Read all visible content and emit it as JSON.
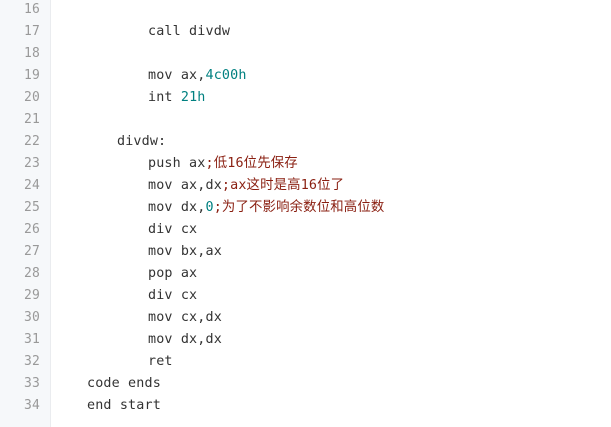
{
  "code_view": {
    "lines": [
      {
        "number": "16",
        "indent": 0,
        "segments": []
      },
      {
        "number": "17",
        "indent": 3,
        "segments": [
          {
            "text": "call divdw",
            "kind": "plain"
          }
        ]
      },
      {
        "number": "18",
        "indent": 0,
        "segments": []
      },
      {
        "number": "19",
        "indent": 3,
        "segments": [
          {
            "text": "mov ax,",
            "kind": "plain"
          },
          {
            "text": "4c00h",
            "kind": "num"
          }
        ]
      },
      {
        "number": "20",
        "indent": 3,
        "segments": [
          {
            "text": "int ",
            "kind": "plain"
          },
          {
            "text": "21h",
            "kind": "num"
          }
        ]
      },
      {
        "number": "21",
        "indent": 0,
        "segments": []
      },
      {
        "number": "22",
        "indent": 2,
        "segments": [
          {
            "text": "divdw:",
            "kind": "plain"
          }
        ]
      },
      {
        "number": "23",
        "indent": 3,
        "segments": [
          {
            "text": "push ax",
            "kind": "plain"
          },
          {
            "text": ";低16位先保存",
            "kind": "cmt"
          }
        ]
      },
      {
        "number": "24",
        "indent": 3,
        "segments": [
          {
            "text": "mov ax,dx",
            "kind": "plain"
          },
          {
            "text": ";ax这时是高16位了",
            "kind": "cmt"
          }
        ]
      },
      {
        "number": "25",
        "indent": 3,
        "segments": [
          {
            "text": "mov dx,",
            "kind": "plain"
          },
          {
            "text": "0",
            "kind": "num"
          },
          {
            "text": ";为了不影响余数位和高位数",
            "kind": "cmt"
          }
        ]
      },
      {
        "number": "26",
        "indent": 3,
        "segments": [
          {
            "text": "div cx",
            "kind": "plain"
          }
        ]
      },
      {
        "number": "27",
        "indent": 3,
        "segments": [
          {
            "text": "mov bx,ax",
            "kind": "plain"
          }
        ]
      },
      {
        "number": "28",
        "indent": 3,
        "segments": [
          {
            "text": "pop ax",
            "kind": "plain"
          }
        ]
      },
      {
        "number": "29",
        "indent": 3,
        "segments": [
          {
            "text": "div cx",
            "kind": "plain"
          }
        ]
      },
      {
        "number": "30",
        "indent": 3,
        "segments": [
          {
            "text": "mov cx,dx",
            "kind": "plain"
          }
        ]
      },
      {
        "number": "31",
        "indent": 3,
        "segments": [
          {
            "text": "mov dx,dx",
            "kind": "plain"
          }
        ]
      },
      {
        "number": "32",
        "indent": 3,
        "segments": [
          {
            "text": "ret",
            "kind": "plain"
          }
        ]
      },
      {
        "number": "33",
        "indent": 1,
        "segments": [
          {
            "text": "code ends",
            "kind": "plain"
          }
        ]
      },
      {
        "number": "34",
        "indent": 1,
        "segments": [
          {
            "text": "end start",
            "kind": "plain"
          }
        ]
      }
    ]
  },
  "colors": {
    "gutter_background": "#f6f8fa",
    "line_number": "#999999",
    "code_text": "#333333",
    "number_literal": "#008080",
    "comment": "#8a1f11"
  }
}
